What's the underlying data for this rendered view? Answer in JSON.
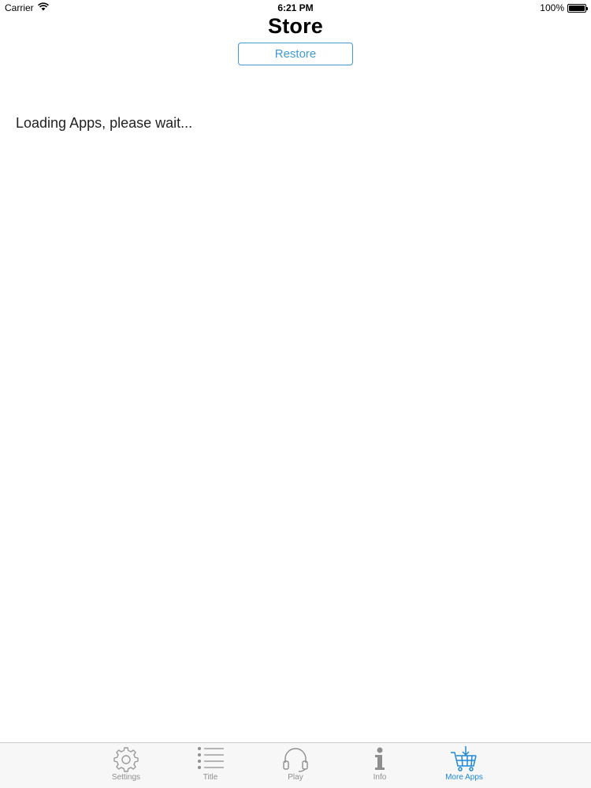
{
  "status_bar": {
    "carrier": "Carrier",
    "time": "6:21 PM",
    "battery": "100%",
    "battery_level": 1.0
  },
  "nav": {
    "title": "Store",
    "restore_label": "Restore"
  },
  "main": {
    "loading_text": "Loading Apps, please wait..."
  },
  "tab_bar": {
    "active_color": "#1e88d8",
    "inactive_color": "#8e8e8e",
    "items": [
      {
        "label": "Settings",
        "icon": "gear-icon",
        "active": false
      },
      {
        "label": "Title",
        "icon": "list-icon",
        "active": false
      },
      {
        "label": "Play",
        "icon": "headphones-icon",
        "active": false
      },
      {
        "label": "Info",
        "icon": "info-icon",
        "active": false
      },
      {
        "label": "More Apps",
        "icon": "cart-download-icon",
        "active": true
      }
    ]
  }
}
